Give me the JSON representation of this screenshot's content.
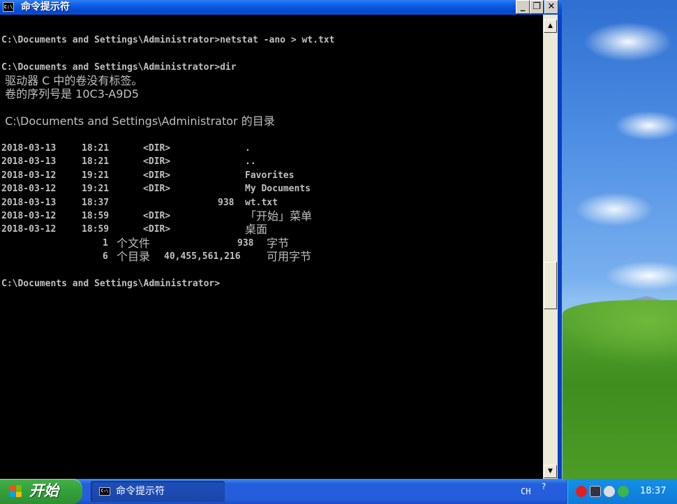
{
  "window": {
    "title": "命令提示符",
    "icon_text": "C:\\",
    "buttons": {
      "minimize": "_",
      "maximize": "❐",
      "close": "✕"
    }
  },
  "console_lines": [
    {
      "text": "C:\\Documents and Settings\\Administrator>netstat -ano > wt.txt"
    },
    {
      "text": "C:\\Documents and Settings\\Administrator>dir"
    },
    {
      "text": " 驱动器 C 中的卷没有标签。"
    },
    {
      "text": " 卷的序列号是 10C3-A9D5"
    },
    {
      "text": " C:\\Documents and Settings\\Administrator 的目录"
    },
    {
      "date": "2018-03-13",
      "time": "18:21",
      "dir": "<DIR>",
      "size": "",
      "name": "."
    },
    {
      "date": "2018-03-13",
      "time": "18:21",
      "dir": "<DIR>",
      "size": "",
      "name": ".."
    },
    {
      "date": "2018-03-12",
      "time": "19:21",
      "dir": "<DIR>",
      "size": "",
      "name": "Favorites"
    },
    {
      "date": "2018-03-12",
      "time": "19:21",
      "dir": "<DIR>",
      "size": "",
      "name": "My Documents"
    },
    {
      "date": "2018-03-13",
      "time": "18:37",
      "dir": "",
      "size": "938",
      "name": "wt.txt"
    },
    {
      "date": "2018-03-12",
      "time": "18:59",
      "dir": "<DIR>",
      "size": "",
      "name": "「开始」菜单"
    },
    {
      "date": "2018-03-12",
      "time": "18:59",
      "dir": "<DIR>",
      "size": "",
      "name": "桌面"
    },
    {
      "count": "1",
      "label": "个文件",
      "value": "938",
      "unit": "字节"
    },
    {
      "count": "6",
      "label": "个目录",
      "value": "40,455,561,216",
      "unit": "可用字节"
    },
    {
      "text": "C:\\Documents and Settings\\Administrator>"
    }
  ],
  "scrollbar": {
    "up": "▲",
    "down": "▼"
  },
  "taskbar": {
    "start_label": "开始",
    "task_label": "命令提示符",
    "language": "CH",
    "ime": "?",
    "clock": "18:37"
  },
  "colors": {
    "console_bg": "#000000",
    "console_text": "#c0c0c0",
    "titlebar": "#0a5ce0",
    "taskbar": "#245edc",
    "start": "#36a33d"
  }
}
